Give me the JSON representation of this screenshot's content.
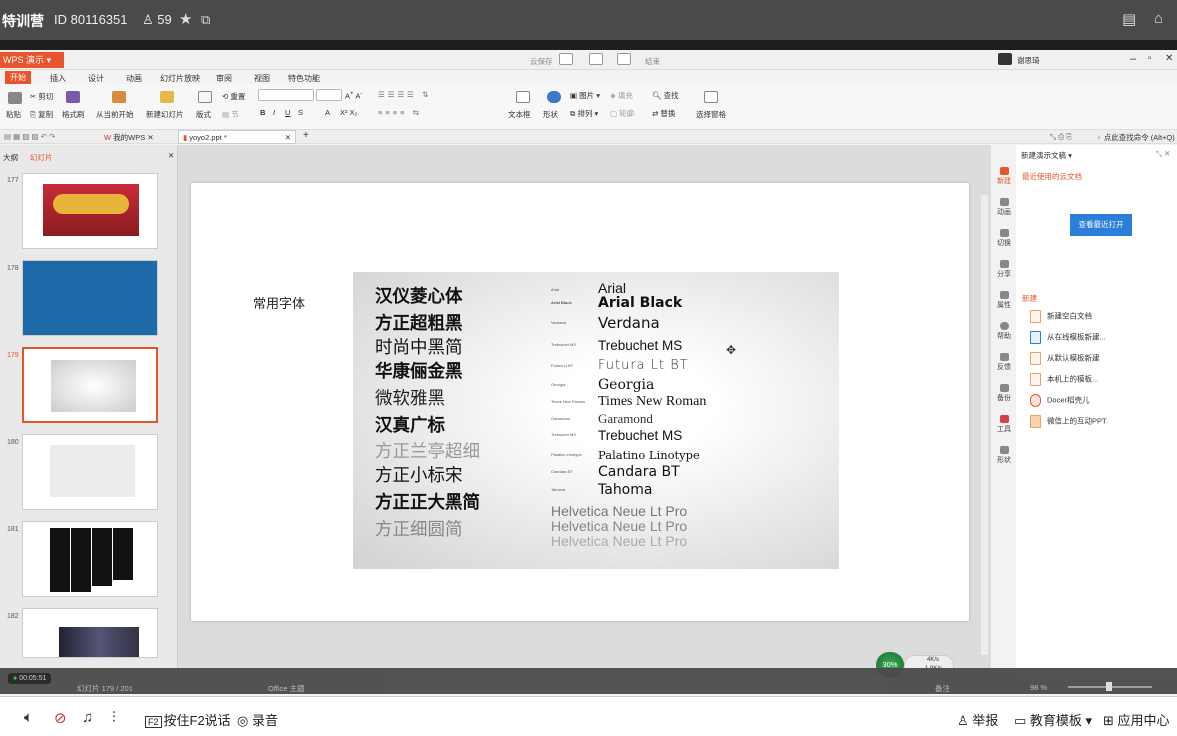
{
  "top_bar": {
    "title": "特训营",
    "room_id": "ID 80116351",
    "viewers": "59"
  },
  "wps": {
    "app_name": "WPS 演示",
    "title_center_a": "云保存",
    "title_center_b": "结束",
    "user_name": "谢思琦",
    "menu_tabs": [
      "开始",
      "插入",
      "设计",
      "动画",
      "幻灯片放映",
      "审阅",
      "视图",
      "特色功能"
    ],
    "ribbon": {
      "paste": "粘贴",
      "cut": "剪切",
      "copy": "复制",
      "format_painter": "格式刷",
      "from_current": "从当前开始",
      "new_slide": "新建幻灯片",
      "layout": "版式",
      "reset": "重置",
      "section": "节",
      "text_box": "文本框",
      "shape": "形状",
      "picture": "图片",
      "fill": "填充",
      "arrange": "排列",
      "outline": "轮廓",
      "find": "查找",
      "replace": "替换",
      "select_pane": "选择窗格"
    },
    "doc_tabs": [
      "我的WPS",
      "yoyo2.ppt *"
    ],
    "command_search": "点此查找命令 (Alt+Q)",
    "left_tabs": [
      "大纲",
      "幻灯片"
    ],
    "thumbnails": [
      {
        "num": "177"
      },
      {
        "num": "178"
      },
      {
        "num": "179"
      },
      {
        "num": "180"
      },
      {
        "num": "181"
      },
      {
        "num": "182"
      }
    ],
    "slide": {
      "title": "常用字体",
      "chinese_fonts": [
        "汉仪菱心体",
        "方正超粗黑",
        "时尚中黑简",
        "华康俪金黑",
        "微软雅黑",
        "汉真广标",
        "方正兰亭超细",
        "方正小标宋",
        "方正正大黑简",
        "方正细圆简"
      ],
      "english_fonts": [
        "Arial",
        "Arial Black",
        "Verdana",
        "Trebuchet MS",
        "Futura Lt BT",
        "Georgia",
        "Times New Roman",
        "Garamond",
        "Trebuchet MS",
        "Palatino Linotype",
        "Candara BT",
        "Tahoma"
      ],
      "english_small_labels": [
        "Arial",
        "Arial Black",
        "Verdana",
        "Trebuchet MS",
        "Futura Lt BT",
        "Georgia",
        "Times New Roman",
        "Garamond",
        "Trebuchet MS",
        "Palatino Linotype",
        "Candara BT",
        "Tahoma"
      ],
      "helvetica": [
        "Helvetica Neue Lt Pro",
        "Helvetica Neue Lt Pro",
        "Helvetica Neue Lt Pro"
      ]
    },
    "right_strip": [
      "新建",
      "动画",
      "切换",
      "分享",
      "属性",
      "帮助",
      "反馈",
      "备份",
      "工具",
      "形状"
    ],
    "task_pane": {
      "header": "新建演示文稿",
      "recent_cloud": "最近使用的云文档",
      "view_recent_btn": "查看最近打开",
      "new_section": "新建",
      "items": [
        "新建空白文档",
        "从在线模板新建...",
        "从默认模板新建",
        "本机上的模板...",
        "Docer稻壳儿",
        "微信上的互动PPT"
      ]
    },
    "status": {
      "timer": "00:05:51",
      "slide_pos": "幻灯片 179 / 201",
      "theme": "Office 主题",
      "notes": "备注",
      "zoom": "98 %",
      "cpu": "30%",
      "net_up": "4K/s",
      "net_down": "1.9K/s"
    }
  },
  "bottom_bar": {
    "f2_talk": "按住F2说话",
    "record": "录音",
    "report": "举报",
    "edu_template": "教育模板",
    "app_center": "应用中心"
  }
}
